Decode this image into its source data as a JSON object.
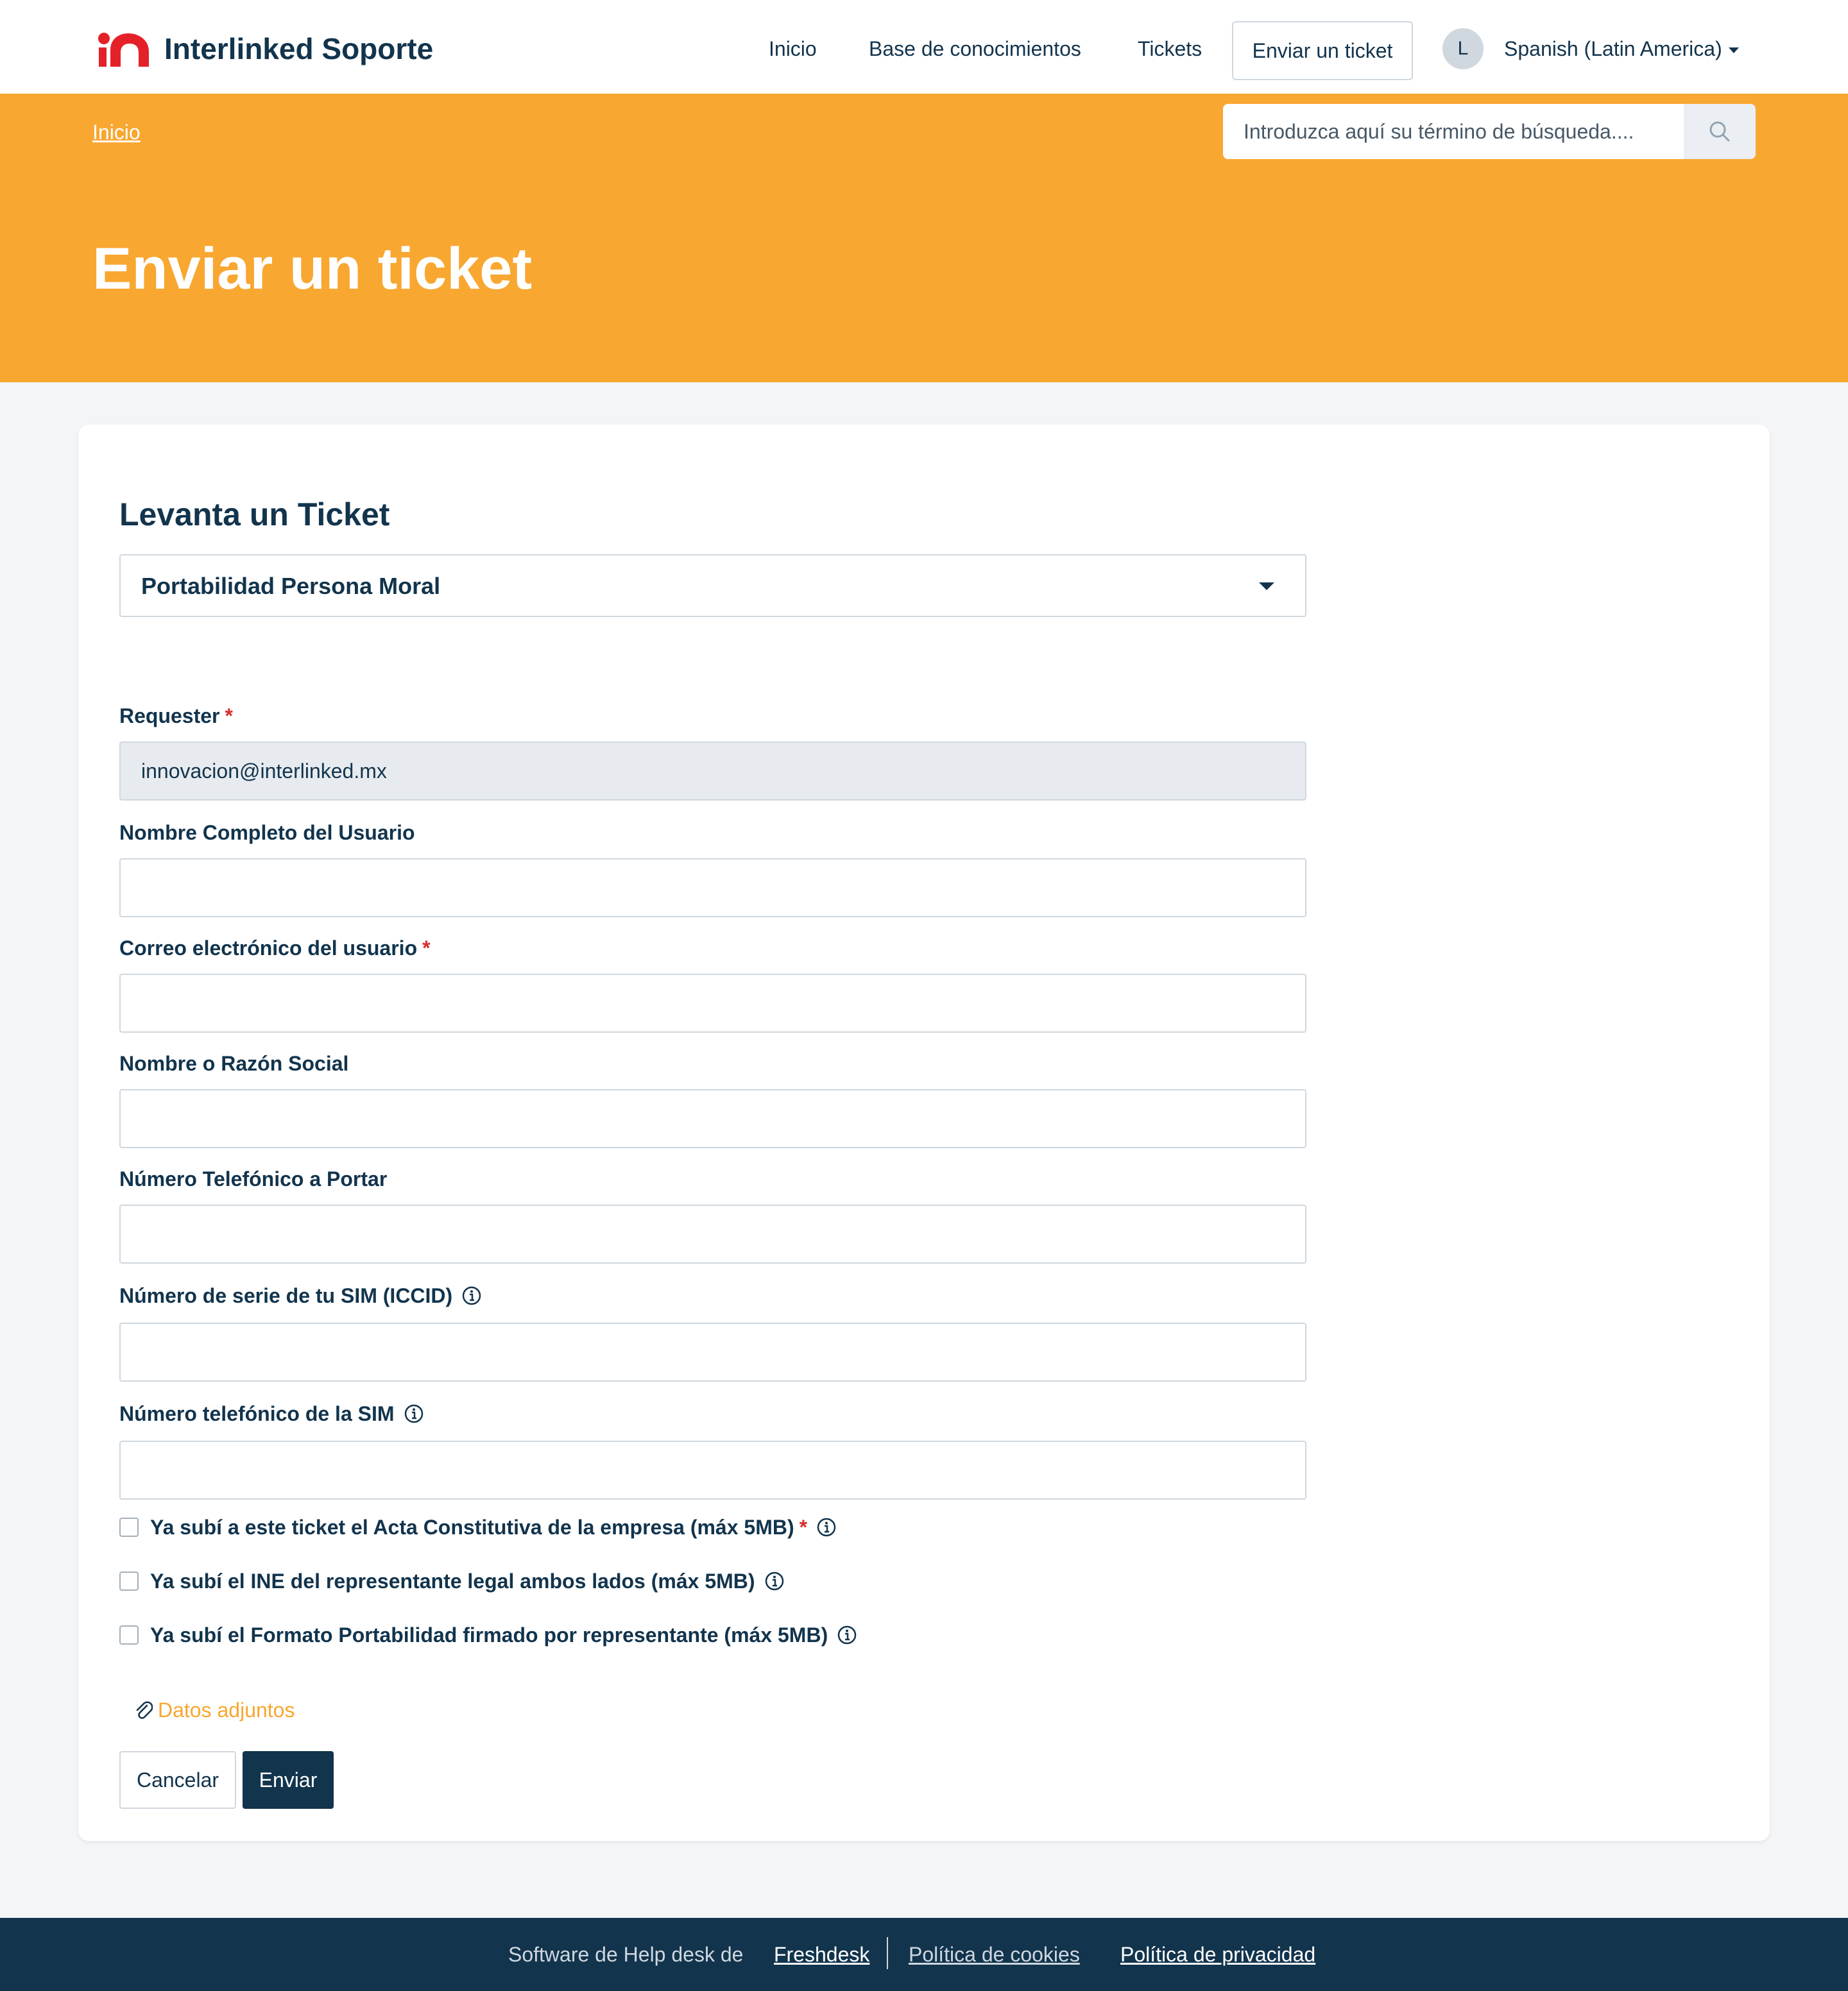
{
  "header": {
    "brand": "Interlinked Soporte",
    "nav": {
      "home": "Inicio",
      "knowledge_base": "Base de conocimientos",
      "tickets": "Tickets",
      "submit_ticket": "Enviar un ticket"
    },
    "avatar_initial": "L",
    "language": "Spanish (Latin America)"
  },
  "banner": {
    "breadcrumb": "Inicio",
    "search_placeholder": "Introduzca aquí su término de búsqueda....",
    "page_title": "Enviar un ticket"
  },
  "form": {
    "title": "Levanta un Ticket",
    "ticket_type": "Portabilidad Persona Moral",
    "required_mark": "*",
    "fields": {
      "requester": {
        "label": "Requester",
        "value": "innovacion@interlinked.mx"
      },
      "full_name": {
        "label": "Nombre Completo del Usuario",
        "value": ""
      },
      "user_email": {
        "label": "Correo electrónico del usuario",
        "value": ""
      },
      "company_name": {
        "label": "Nombre o Razón Social",
        "value": ""
      },
      "phone_to_port": {
        "label": "Número Telefónico a Portar",
        "value": ""
      },
      "sim_serial": {
        "label": "Número de serie de tu SIM (ICCID)",
        "value": ""
      },
      "sim_phone": {
        "label": "Número telefónico de la SIM",
        "value": ""
      }
    },
    "checkboxes": {
      "acta": {
        "label": "Ya subí a este ticket el Acta Constitutiva de la empresa (máx 5MB)",
        "checked": false
      },
      "ine": {
        "label": "Ya subí el INE del representante legal ambos lados (máx 5MB)",
        "checked": false
      },
      "formato": {
        "label": "Ya subí el Formato Portabilidad firmado por representante (máx 5MB)",
        "checked": false
      }
    },
    "attachments_label": "Datos adjuntos",
    "cancel_label": "Cancelar",
    "submit_label": "Enviar"
  },
  "footer": {
    "text": "Software de Help desk de",
    "freshdesk": "Freshdesk",
    "cookies": "Política de cookies",
    "privacy": "Política de privacidad"
  },
  "colors": {
    "brand_orange": "#f8a731",
    "brand_navy": "#12344d",
    "logo_red": "#e42129",
    "required_red": "#d72d30"
  },
  "icons": [
    "logo-icon",
    "search-icon",
    "info-icon",
    "paperclip-icon",
    "chevron-down-icon"
  ]
}
